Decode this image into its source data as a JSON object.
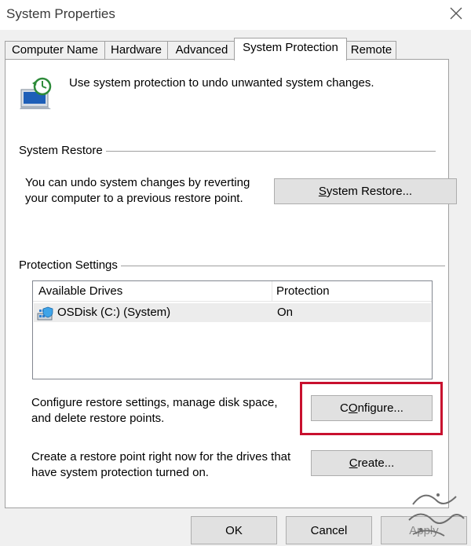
{
  "window": {
    "title": "System Properties"
  },
  "icons": {
    "close": "close-icon",
    "app": "system-protection-icon",
    "drive": "drive-icon"
  },
  "tabs": [
    {
      "label": "Computer Name",
      "active": false
    },
    {
      "label": "Hardware",
      "active": false
    },
    {
      "label": "Advanced",
      "active": false
    },
    {
      "label": "System Protection",
      "active": true
    },
    {
      "label": "Remote",
      "active": false
    }
  ],
  "intro": {
    "text": "Use system protection to undo unwanted system changes."
  },
  "system_restore": {
    "group_label": "System Restore",
    "description_line1": "You can undo system changes by reverting",
    "description_line2": "your computer to a previous restore point.",
    "button_mnemonic": "S",
    "button_rest": "ystem Restore..."
  },
  "protection_settings": {
    "group_label": "Protection Settings",
    "columns": [
      "Available Drives",
      "Protection"
    ],
    "rows": [
      {
        "drive": "OSDisk (C:) (System)",
        "protection": "On"
      }
    ]
  },
  "configure": {
    "description_line1": "Configure restore settings, manage disk space,",
    "description_line2": "and delete restore points.",
    "button_mnemonic": "O",
    "button_label_pre": "C",
    "button_label_post": "nfigure..."
  },
  "create": {
    "description_line1": "Create a restore point right now for the drives that",
    "description_line2": "have system protection turned on.",
    "button_mnemonic": "C",
    "button_rest": "reate..."
  },
  "dialog_buttons": {
    "ok": "OK",
    "cancel": "Cancel",
    "apply": "Apply"
  },
  "colors": {
    "highlight": "#c8102e",
    "button_bg": "#e1e1e1",
    "window_bg": "#f0f0f0"
  }
}
